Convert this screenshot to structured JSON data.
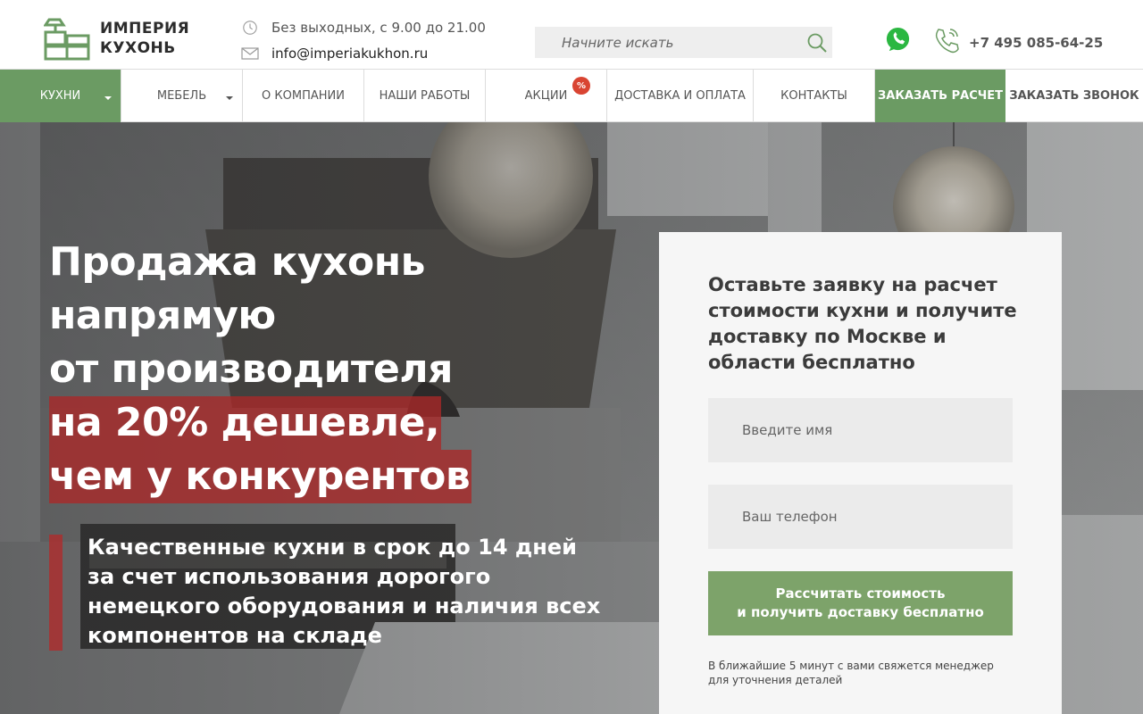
{
  "header": {
    "logo": {
      "line1": "ИМПЕРИЯ",
      "line2": "КУХОНЬ",
      "icon": "kitchen-logo-icon"
    },
    "hours": "Без выходных, с 9.00 до 21.00",
    "email": "info@imperiakukhon.ru",
    "search": {
      "placeholder": "Начните искать"
    },
    "phone": "+7 495 085-64-25"
  },
  "nav": {
    "items": [
      {
        "label": "КУХНИ"
      },
      {
        "label": "МЕБЕЛЬ"
      },
      {
        "label": "О КОМПАНИИ"
      },
      {
        "label": "НАШИ РАБОТЫ"
      },
      {
        "label": "АКЦИИ",
        "badge": "%"
      },
      {
        "label": "ДОСТАВКА И ОПЛАТА"
      },
      {
        "label": "КОНТАКТЫ"
      }
    ],
    "cta_calc": "ЗАКАЗАТЬ РАСЧЕТ",
    "cta_call": "ЗАКАЗАТЬ ЗВОНОК"
  },
  "hero": {
    "title_lines": [
      "Продажа кухонь",
      "напрямую",
      "от производителя",
      "на 20% дешевле,",
      "чем у конкурентов"
    ],
    "subtitle": "Качественные кухни в срок до 14 дней за счет использования дорогого немецкого оборудования и наличия всех компонентов на складе"
  },
  "form": {
    "title": "Оставьте заявку на расчет стоимости кухни и получите доставку по Москве и области бесплатно",
    "name_placeholder": "Введите имя",
    "phone_placeholder": "Ваш телефон",
    "submit_line1": "Рассчитать стоимость",
    "submit_line2": "и получить доставку бесплатно",
    "note": "В ближайшие 5 минут с вами свяжется менеджер для уточнения деталей"
  },
  "colors": {
    "accent_green": "#6b9b63",
    "button_green": "#7da36a",
    "highlight_red": "#aa2828",
    "badge_red": "#d94432"
  }
}
